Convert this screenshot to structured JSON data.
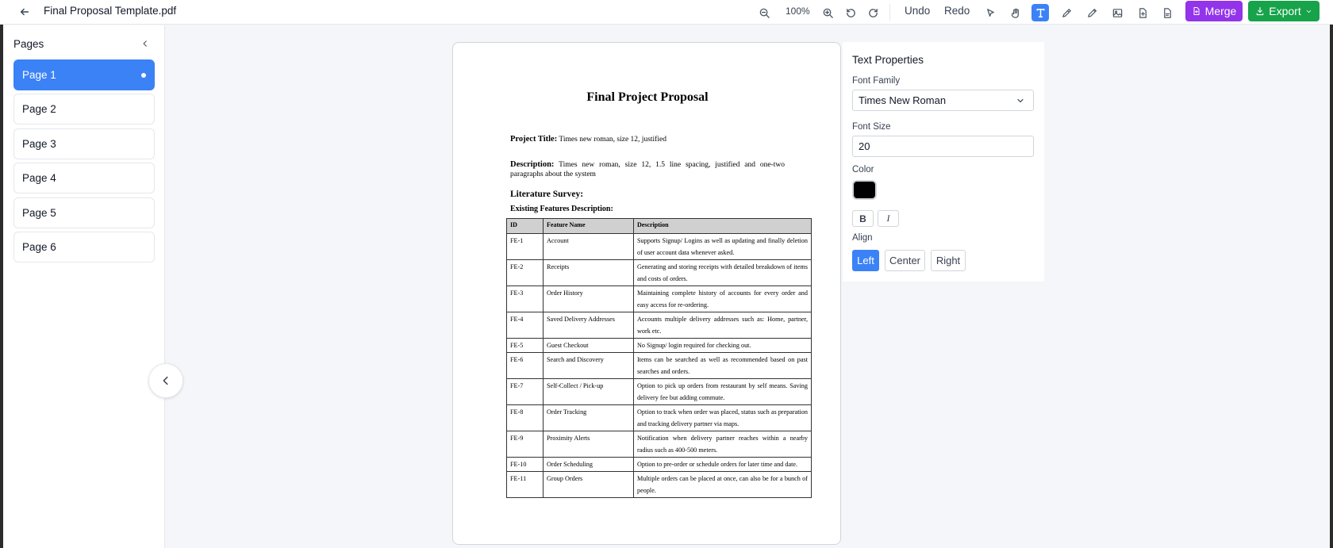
{
  "header": {
    "file_title": "Final Proposal Template.pdf",
    "zoom": "100%",
    "undo_label": "Undo",
    "redo_label": "Redo",
    "merge_label": "Merge",
    "export_label": "Export"
  },
  "sidebar": {
    "title": "Pages",
    "pages": [
      {
        "label": "Page 1",
        "active": true
      },
      {
        "label": "Page 2",
        "active": false
      },
      {
        "label": "Page 3",
        "active": false
      },
      {
        "label": "Page 4",
        "active": false
      },
      {
        "label": "Page 5",
        "active": false
      },
      {
        "label": "Page 6",
        "active": false
      }
    ]
  },
  "document": {
    "title": "Final Project Proposal",
    "project_title_label": "Project Title:",
    "project_title_value": "Times new roman, size 12, justified",
    "description_label": "Description:",
    "description_value": "Times new roman, size 12, 1.5 line spacing, justified and one-two paragraphs about the system",
    "literature_survey": "Literature Survey:",
    "existing_features": "Existing Features Description:",
    "table_headers": [
      "ID",
      "Feature Name",
      "Description"
    ],
    "table_rows": [
      [
        "FE-1",
        "Account",
        "Supports Signup/ Logins as well as updating and finally deletion of user account data whenever asked."
      ],
      [
        "FE-2",
        "Receipts",
        "Generating and storing receipts with detailed breakdown of items and costs of orders."
      ],
      [
        "FE-3",
        "Order History",
        "Maintaining complete history of accounts for every order and easy access for re-ordering."
      ],
      [
        "FE-4",
        "Saved Delivery Addresses",
        "Accounts multiple delivery addresses such as: Home, partner, work etc."
      ],
      [
        "FE-5",
        "Guest Checkout",
        "No Signup/ login required for checking out."
      ],
      [
        "FE-6",
        "Search and Discovery",
        "Items can be searched as well as recommended based on past searches and orders."
      ],
      [
        "FE-7",
        "Self-Collect / Pick-up",
        "Option to pick up orders from restaurant by self means. Saving delivery fee but adding commute."
      ],
      [
        "FE-8",
        "Order Tracking",
        "Option to track when order was placed, status such as preparation and tracking delivery partner via maps."
      ],
      [
        "FE-9",
        "Proximity Alerts",
        "Notification when delivery partner reaches within a nearby radius such as 400-500 meters."
      ],
      [
        "FE-10",
        "Order Scheduling",
        "Option to pre-order or schedule orders for later time and date."
      ],
      [
        "FE-11",
        "Group Orders",
        "Multiple orders can be placed at once, can also be for a bunch of people."
      ]
    ]
  },
  "properties": {
    "title": "Text Properties",
    "font_family_label": "Font Family",
    "font_family_value": "Times New Roman",
    "font_size_label": "Font Size",
    "font_size_value": "20",
    "color_label": "Color",
    "color_value": "#000000",
    "bold_label": "B",
    "italic_label": "I",
    "align_label": "Align",
    "align_left": "Left",
    "align_center": "Center",
    "align_right": "Right"
  },
  "colors": {
    "accent": "#3b82f6",
    "merge": "#9333ea",
    "export": "#16a34a"
  }
}
